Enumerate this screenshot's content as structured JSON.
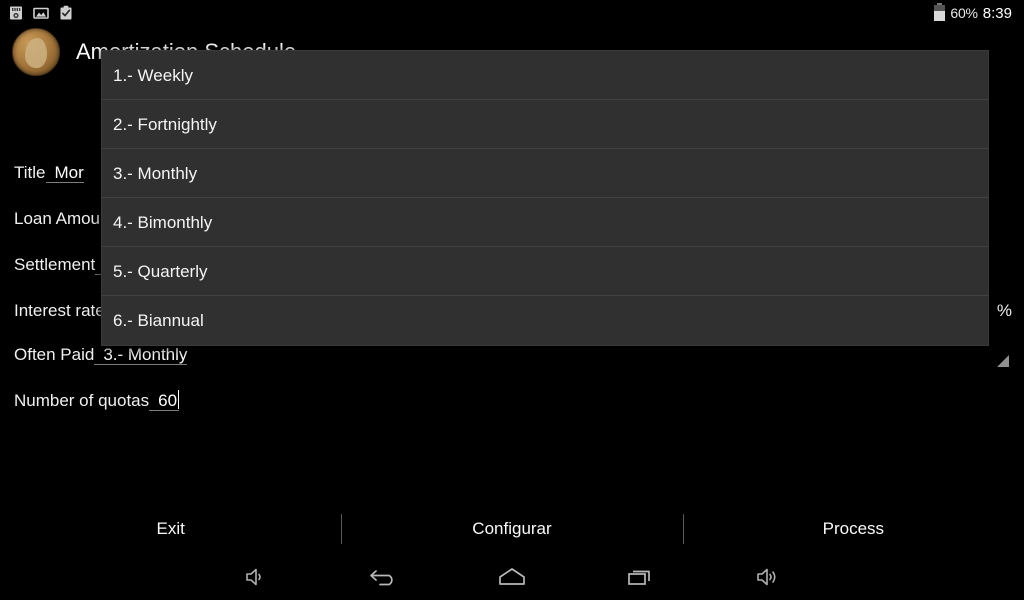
{
  "statusbar": {
    "icons": [
      "sd-card-icon",
      "image-icon",
      "clipboard-check-icon"
    ],
    "battery_percent": "60%",
    "time": "8:39",
    "battery_level": 60
  },
  "header": {
    "avatar_icon": "coin-avatar-icon",
    "title": "Amortization Schedule"
  },
  "form": {
    "fields": [
      {
        "label": "Title",
        "value": "Mor",
        "suffix": "",
        "type": "text"
      },
      {
        "label": "Loan Amount",
        "value": "",
        "suffix": "",
        "type": "text"
      },
      {
        "label": "Settlement",
        "value": "",
        "suffix": "",
        "type": "text"
      },
      {
        "label": "Interest rate",
        "value": "",
        "suffix": "%",
        "type": "text"
      },
      {
        "label": "Often Paid",
        "value": "3.- Monthly",
        "suffix": "",
        "type": "spinner"
      },
      {
        "label": "Number of quotas",
        "value": "60",
        "suffix": "",
        "type": "text"
      }
    ]
  },
  "dropdown": {
    "name": "often-paid-options",
    "items": [
      {
        "label": "1.- Weekly"
      },
      {
        "label": "2.- Fortnightly"
      },
      {
        "label": "3.- Monthly"
      },
      {
        "label": "4.- Bimonthly"
      },
      {
        "label": "5.- Quarterly"
      },
      {
        "label": "6.- Biannual"
      }
    ]
  },
  "buttons": [
    {
      "name": "exit-button",
      "label": "Exit"
    },
    {
      "name": "configurar-button",
      "label": "Configurar"
    },
    {
      "name": "process-button",
      "label": "Process"
    }
  ],
  "navbar": {
    "items": [
      {
        "name": "volume-down-icon"
      },
      {
        "name": "back-icon"
      },
      {
        "name": "home-icon"
      },
      {
        "name": "recents-icon"
      },
      {
        "name": "volume-up-icon"
      }
    ]
  },
  "colors": {
    "background": "#000000",
    "popup_background": "#303030",
    "popup_divider": "#434343",
    "text_primary": "#fefefe",
    "underline": "#7d7d7d",
    "accent_coin": "#a8793c"
  }
}
